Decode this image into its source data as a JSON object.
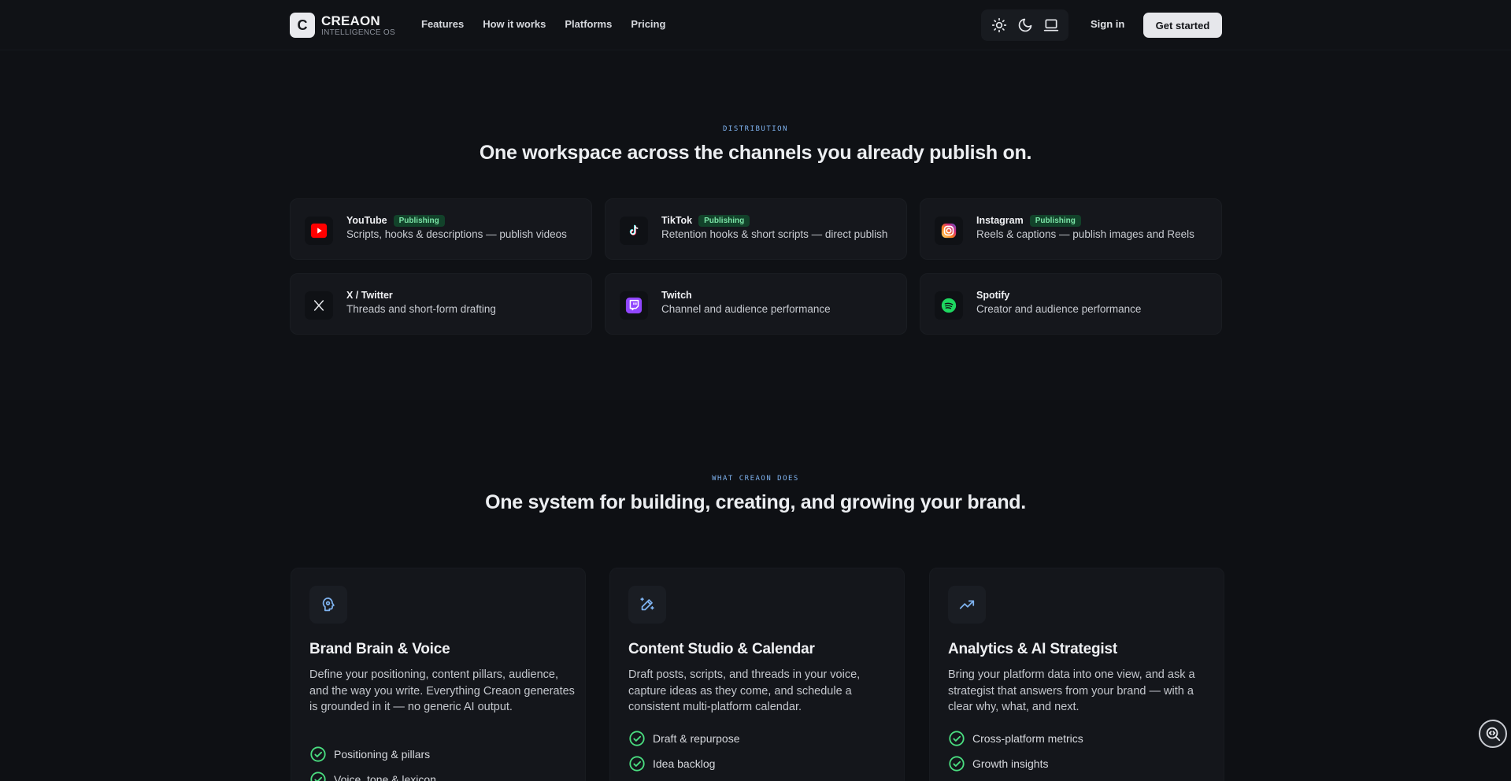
{
  "nav": {
    "brand_initial": "C",
    "brand_name": "CREAON",
    "brand_sub": "INTELLIGENCE OS",
    "links": [
      "Features",
      "How it works",
      "Platforms",
      "Pricing"
    ],
    "theme_icons": [
      "sun-icon",
      "moon-icon",
      "laptop-icon"
    ],
    "sign_in": "Sign in",
    "get_started": "Get started"
  },
  "distribution": {
    "eyebrow": "DISTRIBUTION",
    "title": "One workspace across the channels you already publish on.",
    "platforms": [
      {
        "name": "YouTube",
        "badge": "Publishing",
        "desc": "Scripts, hooks & descriptions — publish videos",
        "icon": "youtube-icon"
      },
      {
        "name": "TikTok",
        "badge": "Publishing",
        "desc": "Retention hooks & short scripts — direct publish",
        "icon": "tiktok-icon"
      },
      {
        "name": "Instagram",
        "badge": "Publishing",
        "desc": "Reels & captions — publish images and Reels",
        "icon": "instagram-icon"
      },
      {
        "name": "X / Twitter",
        "desc": "Threads and short-form drafting",
        "icon": "x-icon"
      },
      {
        "name": "Twitch",
        "desc": "Channel and audience performance",
        "icon": "twitch-icon"
      },
      {
        "name": "Spotify",
        "desc": "Creator and audience performance",
        "icon": "spotify-icon"
      }
    ]
  },
  "what": {
    "eyebrow": "WHAT CREAON DOES",
    "title": "One system for building, creating, and growing your brand.",
    "features": [
      {
        "title": "Brand Brain & Voice",
        "desc": "Define your positioning, content pillars, audience, and the way you write. Everything Creaon generates is grounded in it — no generic AI output.",
        "items": [
          "Positioning & pillars",
          "Voice, tone & lexicon"
        ],
        "icon": "brain-icon"
      },
      {
        "title": "Content Studio & Calendar",
        "desc": "Draft posts, scripts, and threads in your voice, capture ideas as they come, and schedule a consistent multi-platform calendar.",
        "items": [
          "Draft & repurpose",
          "Idea backlog"
        ],
        "icon": "pen-sparkle-icon"
      },
      {
        "title": "Analytics & AI Strategist",
        "desc": "Bring your platform data into one view, and ask a strategist that answers from your brand — with a clear why, what, and next.",
        "items": [
          "Cross-platform metrics",
          "Growth insights"
        ],
        "icon": "trending-up-icon"
      }
    ]
  },
  "colors": {
    "accent": "#7fb3f0",
    "publishing_badge_bg": "#12422a",
    "publishing_badge_text": "#7be3a6",
    "check": "#4ade80"
  }
}
